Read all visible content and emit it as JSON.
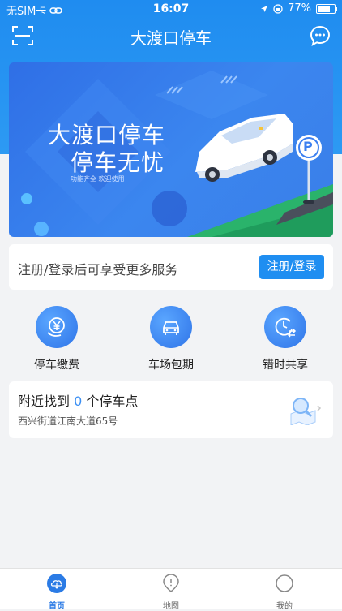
{
  "status_bar": {
    "carrier": "无SIM卡",
    "time": "16:07",
    "battery": "77%"
  },
  "header": {
    "title": "大渡口停车",
    "scan_icon": "scan-icon",
    "message_icon": "chat-bubble-icon"
  },
  "banner": {
    "title_line1": "大渡口停车",
    "title_line2": "停车无忧",
    "subtitle": "功能齐全  欢迎使用",
    "sign_letter": "P"
  },
  "login": {
    "prompt": "注册/登录后可享受更多服务",
    "button": "注册/登录"
  },
  "services": [
    {
      "label": "停车缴费",
      "icon": "yen-coin-icon"
    },
    {
      "label": "车场包期",
      "icon": "car-icon"
    },
    {
      "label": "错时共享",
      "icon": "clock-arrows-icon"
    }
  ],
  "nearby": {
    "prefix": "附近找到",
    "count": "0",
    "suffix": "个停车点",
    "address": "西兴街道江南大道65号"
  },
  "tabs": [
    {
      "label": "首页",
      "active": true
    },
    {
      "label": "地图",
      "active": false
    },
    {
      "label": "我的",
      "active": false
    }
  ],
  "colors": {
    "brand": "#1f8cf0",
    "active_tab": "#2b7be5",
    "count_highlight": "#3b8ff3"
  }
}
